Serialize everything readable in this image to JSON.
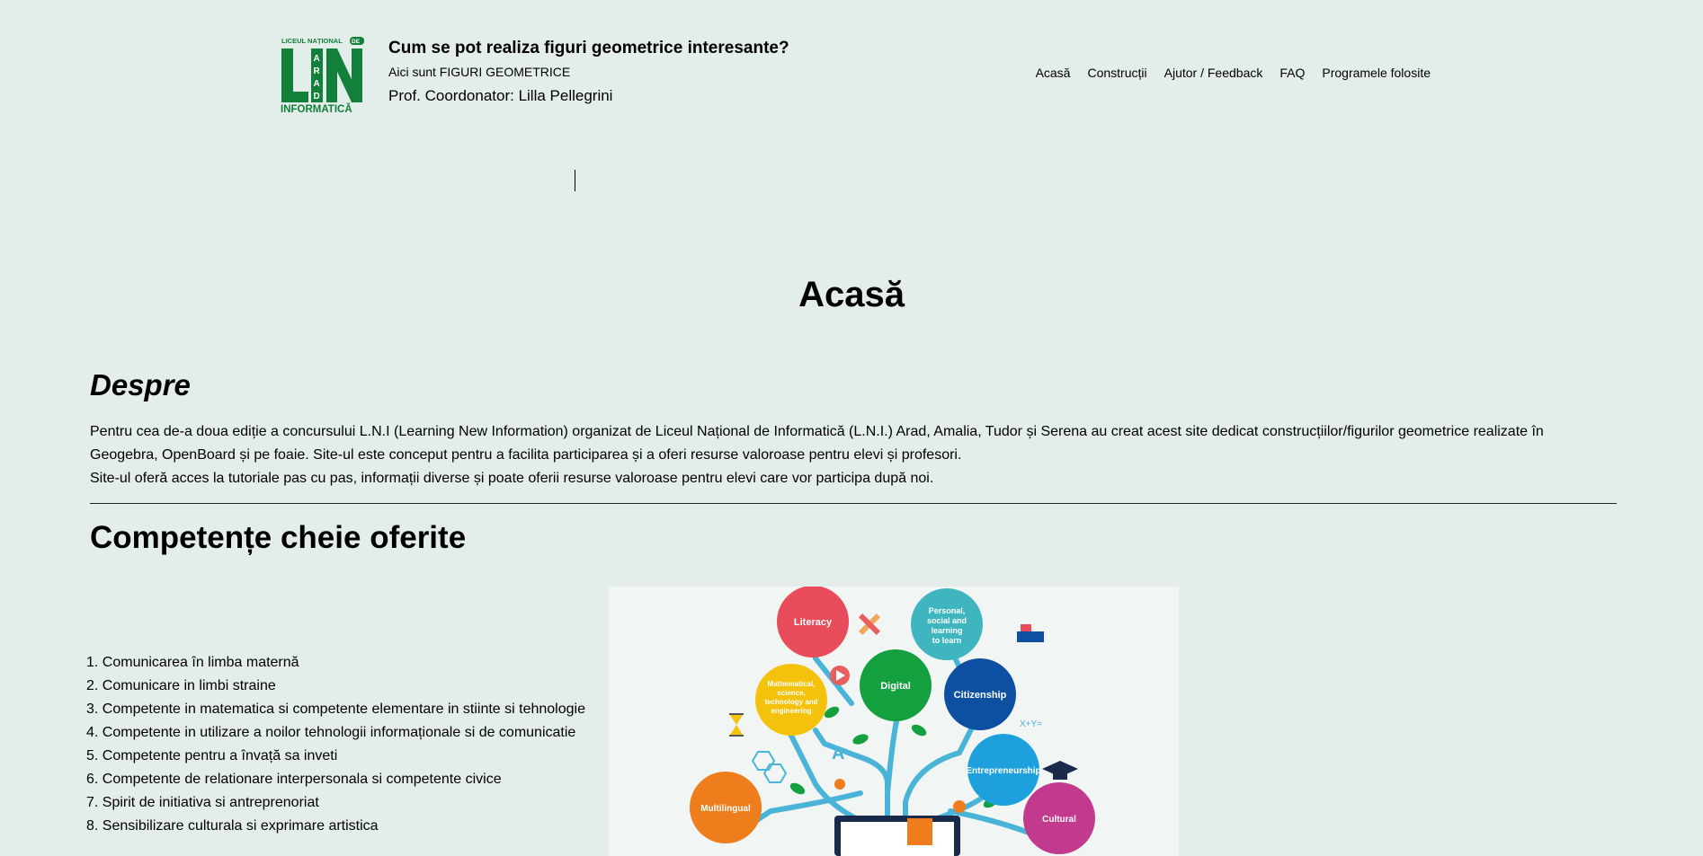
{
  "header": {
    "logo": {
      "top_text": "LICEUL NAȚIONAL",
      "top_suffix": "DE",
      "monogram": "LNI",
      "city": "ARAD",
      "bottom_text": "INFORMATICĂ",
      "color": "#12803a"
    },
    "title": "Cum se pot realiza figuri geometrice interesante?",
    "tagline": "Aici sunt FIGURI GEOMETRICE",
    "coordinator": "Prof. Coordonator: Lilla Pellegrini"
  },
  "nav": {
    "items": [
      "Acasă",
      "Construcții",
      "Ajutor / Feedback",
      "FAQ",
      "Programele folosite"
    ]
  },
  "page": {
    "title": "Acasă"
  },
  "about": {
    "heading": "Despre",
    "paragraph1_line1": "Pentru cea de-a doua ediție a concursului L.N.I (Learning New Information) organizat de Liceul Național de Informatică (L.N.I.) Arad, Amalia, Tudor și Serena au creat acest site dedicat construcțiilor/figurilor geometrice realizate în",
    "paragraph1_line2": "Geogebra, OpenBoard și pe foaie. Site-ul este conceput pentru a facilita participarea și a oferi resurse valoroase pentru elevi și profesori.",
    "paragraph2": "Site-ul oferă acces la tutoriale pas cu pas, informații diverse și poate oferii resurse valoroase pentru elevi care vor participa după noi."
  },
  "competences": {
    "heading": "Competențe cheie oferite",
    "items": [
      "1. Comunicarea în limba maternă",
      "2. Comunicare in limbi straine",
      "3. Competente in matematica si competente elementare in stiinte si tehnologie",
      "4. Competente in utilizare a noilor tehnologii informaționale si de comunicatie",
      "5. Competente pentru a învață sa inveti",
      "6. Competente de relationare interpersonala si competente civice",
      "7. Spirit de initiativa si antreprenoriat",
      "8. Sensibilizare culturala si exprimare artistica"
    ]
  },
  "figure": {
    "bubbles": [
      {
        "label": "Literacy",
        "color": "#e84b5a"
      },
      {
        "label": "Personal, social and learning to learn",
        "color": "#3fb6bf"
      },
      {
        "label": "Mathematical, science, technology and engineering",
        "color": "#f4c20d"
      },
      {
        "label": "Digital",
        "color": "#14a03e"
      },
      {
        "label": "Citizenship",
        "color": "#0d4fa0"
      },
      {
        "label": "Entrepreneurship",
        "color": "#1ea0dc"
      },
      {
        "label": "Multilingual",
        "color": "#ee7d1c"
      },
      {
        "label": "Cultural",
        "color": "#c13a8e"
      }
    ],
    "formula": "X+Y="
  }
}
